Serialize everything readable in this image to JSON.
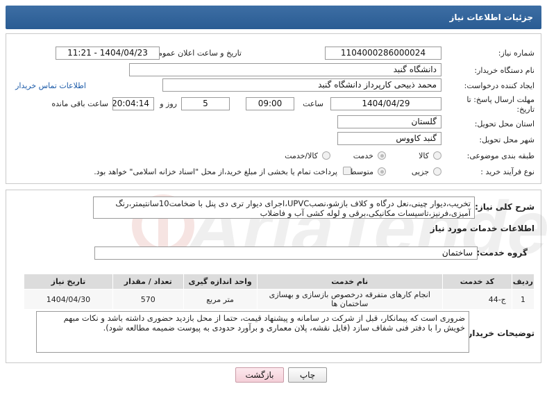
{
  "header": {
    "title": "جزئیات اطلاعات نیاز"
  },
  "form": {
    "need_number": {
      "label": "شماره نیاز:",
      "value": "1104000286000024"
    },
    "announce_datetime": {
      "label": "تاریخ و ساعت اعلان عمومی:",
      "value": "1404/04/23 - 11:21"
    },
    "buyer_org": {
      "label": "نام دستگاه خریدار:",
      "value": "دانشگاه گنبد"
    },
    "requester": {
      "label": "ایجاد کننده درخواست:",
      "value": "محمد ذبیحی کارپرداز دانشگاه گنبد",
      "contact_link": "اطلاعات تماس خریدار"
    },
    "deadline": {
      "label": "مهلت ارسال پاسخ: تا تاریخ:",
      "date": "1404/04/29",
      "time_label": "ساعت",
      "time": "09:00",
      "days": "5",
      "days_label": "روز و",
      "remaining": "20:04:14",
      "remaining_label": "ساعت باقی مانده"
    },
    "province": {
      "label": "استان محل تحویل:",
      "value": "گلستان"
    },
    "city": {
      "label": "شهر محل تحویل:",
      "value": "گنبد کاووس"
    },
    "category": {
      "label": "طبقه بندی موضوعی:",
      "options": [
        "کالا",
        "خدمت",
        "کالا/خدمت"
      ],
      "selected": "خدمت"
    },
    "process_type": {
      "label": "نوع فرآیند خرید :",
      "options": [
        "جزیی",
        "متوسط"
      ],
      "selected": "متوسط",
      "treasury_note": "پرداخت تمام یا بخشی از مبلغ خرید،از محل \"اسناد خزانه اسلامی\" خواهد بود."
    }
  },
  "summary": {
    "label": "شرح کلی نیاز:",
    "text": "تخریب،دیوار چینی،نعل درگاه و کلاف بازشو،نصبUPVC،اجرای دیوار تری دی پنل با ضخامت10سانتیمتر،رنگ آمیزی،فرنیز،تاسیسات مکانیکی،برقی و لوله کشی آب و فاضلاب"
  },
  "services": {
    "section_title": "اطلاعات خدمات مورد نیاز",
    "group_label": "گروه خدمت:",
    "group_value": "ساختمان",
    "table": {
      "headers": [
        "ردیف",
        "کد خدمت",
        "نام خدمت",
        "واحد اندازه گیری",
        "تعداد / مقدار",
        "تاریخ نیاز"
      ],
      "rows": [
        [
          "1",
          "ج-44",
          "انجام کارهای متفرقه درخصوص بازسازی و بهسازی ساختمان ها",
          "متر مربع",
          "570",
          "1404/04/30"
        ]
      ]
    }
  },
  "buyer_notes": {
    "label": "توضیحات خریدار:",
    "text": "ضروری است که پیمانکار، قبل از شرکت در سامانه و پیشنهاد قیمت، حتما از محل بازدید حضوری داشته باشد و نکات مبهم خویش را با دفتر فنی شفاف سازد (فایل نقشه، پلان معماری و برآورد حدودی به پیوست ضمیمه مطالعه شود)."
  },
  "buttons": {
    "print": "چاپ",
    "back": "بازگشت"
  },
  "colors": {
    "header": "#2f6299",
    "link": "#1b5aa8",
    "back_button": "#f4cfd8"
  }
}
